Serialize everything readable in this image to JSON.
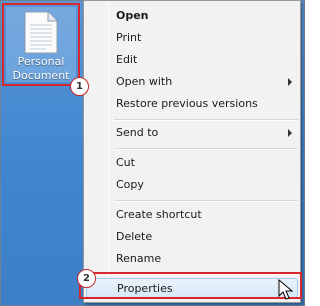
{
  "file": {
    "name_line1": "Personal",
    "name_line2": "Document"
  },
  "badges": {
    "one": "1",
    "two": "2"
  },
  "menu": {
    "open": "Open",
    "print": "Print",
    "edit": "Edit",
    "open_with": "Open with",
    "restore": "Restore previous versions",
    "send_to": "Send to",
    "cut": "Cut",
    "copy": "Copy",
    "create_shortcut": "Create shortcut",
    "delete": "Delete",
    "rename": "Rename",
    "properties": "Properties"
  },
  "colors": {
    "desktop": "#3f86cf",
    "callout": "#d9262c",
    "menu_bg": "#f2f2f2"
  }
}
